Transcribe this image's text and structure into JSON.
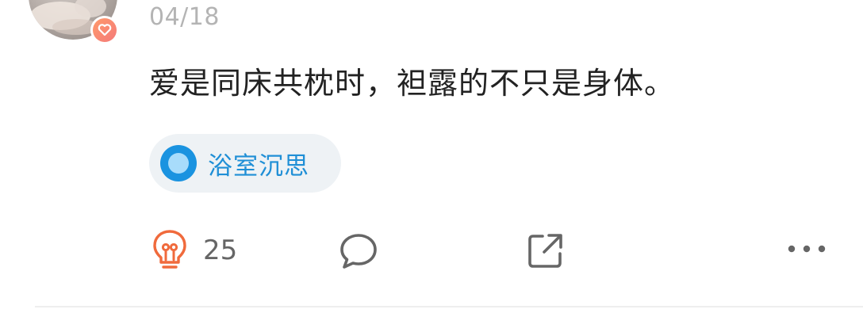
{
  "post": {
    "date": "04/18",
    "content": "爱是同床共枕时，袒露的不只是身体。",
    "topic": {
      "label": "浴室沉思",
      "icon": "topic-circle-icon"
    },
    "actions": {
      "like_icon": "lightbulb-icon",
      "like_count": "25",
      "comment_icon": "comment-bubble-icon",
      "share_icon": "share-external-icon",
      "more_icon": "more-dots-icon"
    },
    "avatar": {
      "badge_icon": "heart-badge-icon"
    }
  },
  "colors": {
    "accent_blue": "#1f8fd6",
    "like_orange": "#f06a3c",
    "text_primary": "#222222",
    "text_muted": "#b4b4b4",
    "icon_gray": "#666666",
    "tag_bg": "#eef2f5"
  }
}
